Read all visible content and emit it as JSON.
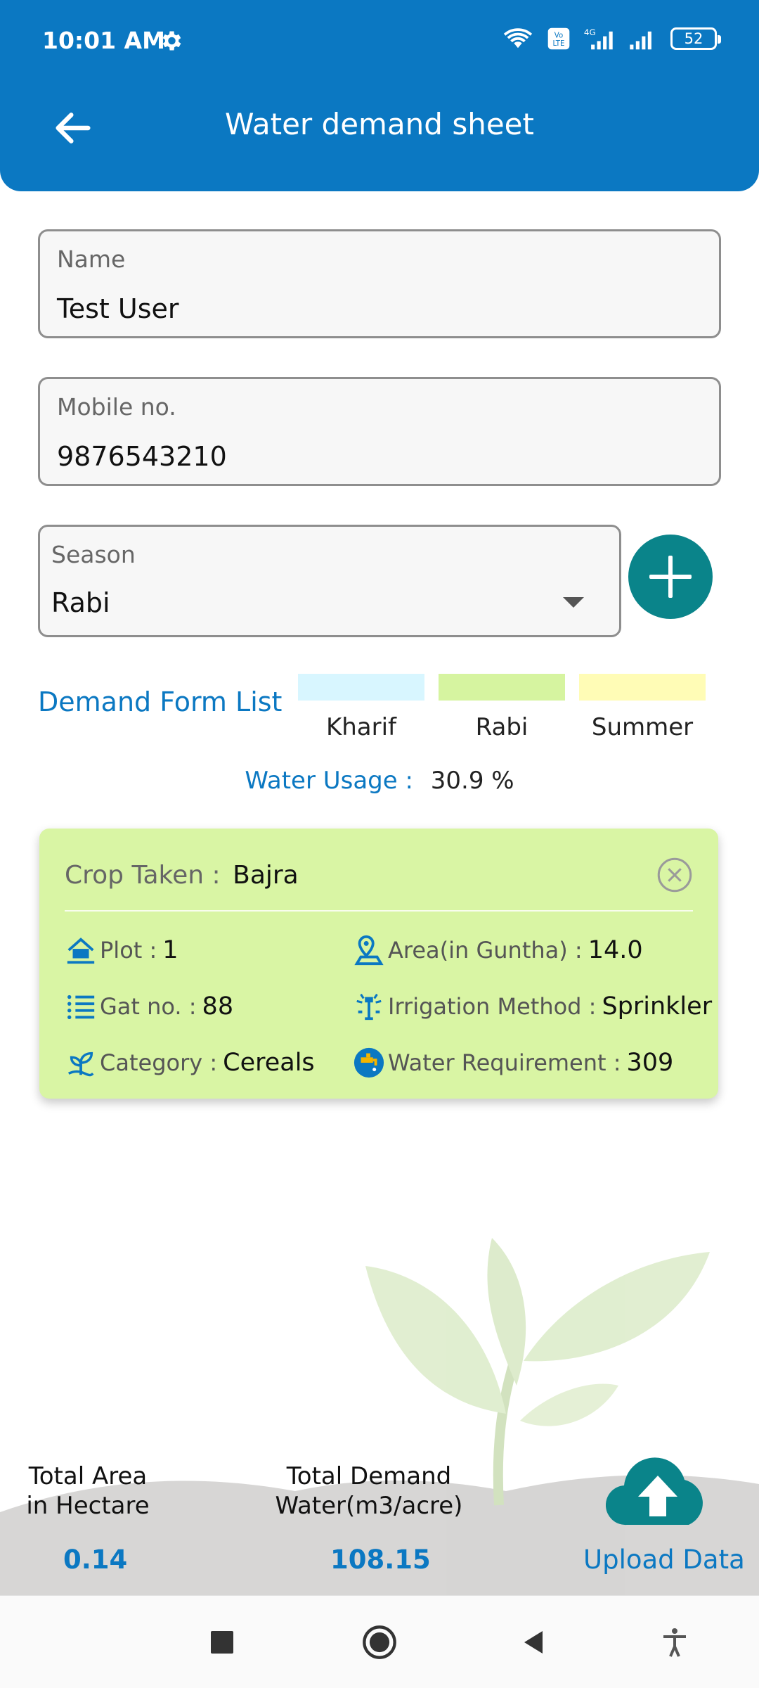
{
  "status_bar": {
    "time": "10:01 AM",
    "battery": "52",
    "icons": [
      "gear-icon",
      "wifi-icon",
      "volte-icon",
      "signal-4g-icon",
      "signal-icon",
      "battery-icon"
    ]
  },
  "header": {
    "title": "Water demand sheet",
    "back_icon": "back-arrow-icon"
  },
  "form": {
    "name": {
      "label": "Name",
      "value": "Test User"
    },
    "mobile": {
      "label": "Mobile no.",
      "value": "9876543210"
    },
    "season": {
      "label": "Season",
      "value": "Rabi"
    },
    "add_icon": "plus-icon"
  },
  "demand_list": {
    "title": "Demand Form List",
    "legend": [
      {
        "label": "Kharif",
        "color": "#d8f6ff"
      },
      {
        "label": "Rabi",
        "color": "#d6f4a0"
      },
      {
        "label": "Summer",
        "color": "#fffcb6"
      }
    ],
    "water_usage": {
      "label": "Water Usage :",
      "value": "30.9 %"
    }
  },
  "card": {
    "crop_label": "Crop Taken :",
    "crop_value": "Bajra",
    "fields": {
      "plot": {
        "label": "Plot :",
        "value": "1",
        "icon": "plot-icon"
      },
      "area": {
        "label": "Area(in Guntha) :",
        "value": "14.0",
        "icon": "area-icon"
      },
      "gat": {
        "label": "Gat no. :",
        "value": "88",
        "icon": "list-icon"
      },
      "irrigation": {
        "label": "Irrigation Method :",
        "value": "Sprinkler",
        "icon": "sprinkler-icon"
      },
      "category": {
        "label": "Category :",
        "value": "Cereals",
        "icon": "plant-icon"
      },
      "water": {
        "label": "Water Requirement :",
        "value": "309",
        "icon": "water-tap-icon"
      }
    },
    "colors": {
      "background": "#d9f5a4"
    }
  },
  "footer": {
    "total_area": {
      "label_line1": "Total Area",
      "label_line2": "in Hectare",
      "value": "0.14"
    },
    "total_demand": {
      "label_line1": "Total Demand",
      "label_line2": "Water(m3/acre)",
      "value": "108.15"
    },
    "upload": {
      "label": "Upload Data",
      "icon": "cloud-upload-icon"
    }
  },
  "colors": {
    "primary": "#0b78c2",
    "accent": "#0a848a"
  },
  "navbar": {
    "icons": [
      "recents-icon",
      "home-icon",
      "back-icon",
      "accessibility-icon"
    ]
  }
}
